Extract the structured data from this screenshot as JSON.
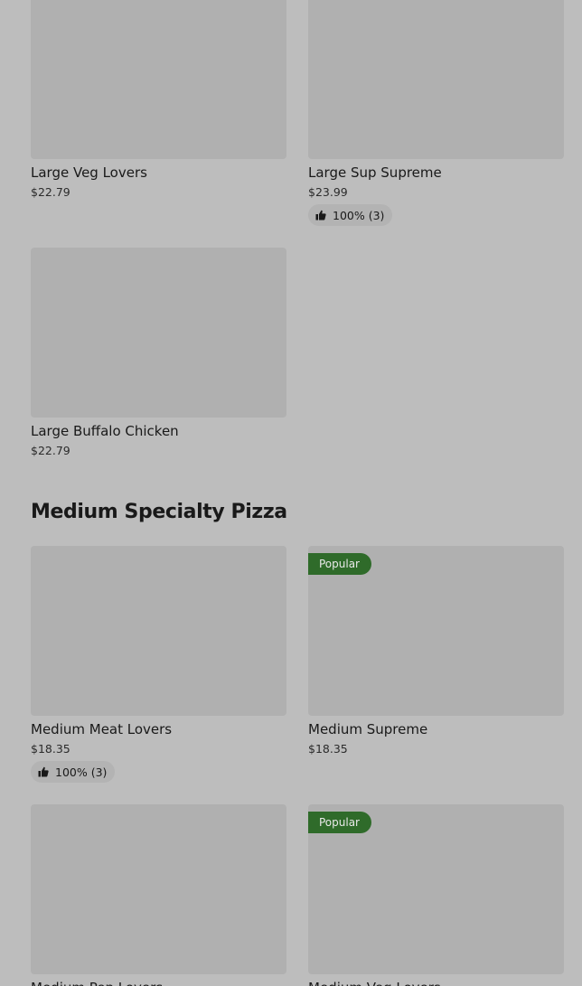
{
  "colors": {
    "background": "#bdbdbd",
    "image_placeholder": "#b0b0b0",
    "popular_badge": "#2f6b2a"
  },
  "large_items": [
    {
      "name": "Large Veg Lovers",
      "price": "$22.79"
    },
    {
      "name": "Large Sup Supreme",
      "price": "$23.99",
      "rating": "100% (3)"
    },
    {
      "name": "Large Buffalo Chicken",
      "price": "$22.79"
    }
  ],
  "medium_section": {
    "title": "Medium Specialty Pizza",
    "items": [
      {
        "name": "Medium Meat Lovers",
        "price": "$18.35",
        "rating": "100% (3)"
      },
      {
        "name": "Medium Supreme",
        "price": "$18.35",
        "badge": "Popular"
      },
      {
        "name": "Medium Pep Lovers"
      },
      {
        "name": "Medium Veg Lovers",
        "badge": "Popular"
      }
    ]
  },
  "icons": {
    "rating": "thumbs-up-icon"
  }
}
